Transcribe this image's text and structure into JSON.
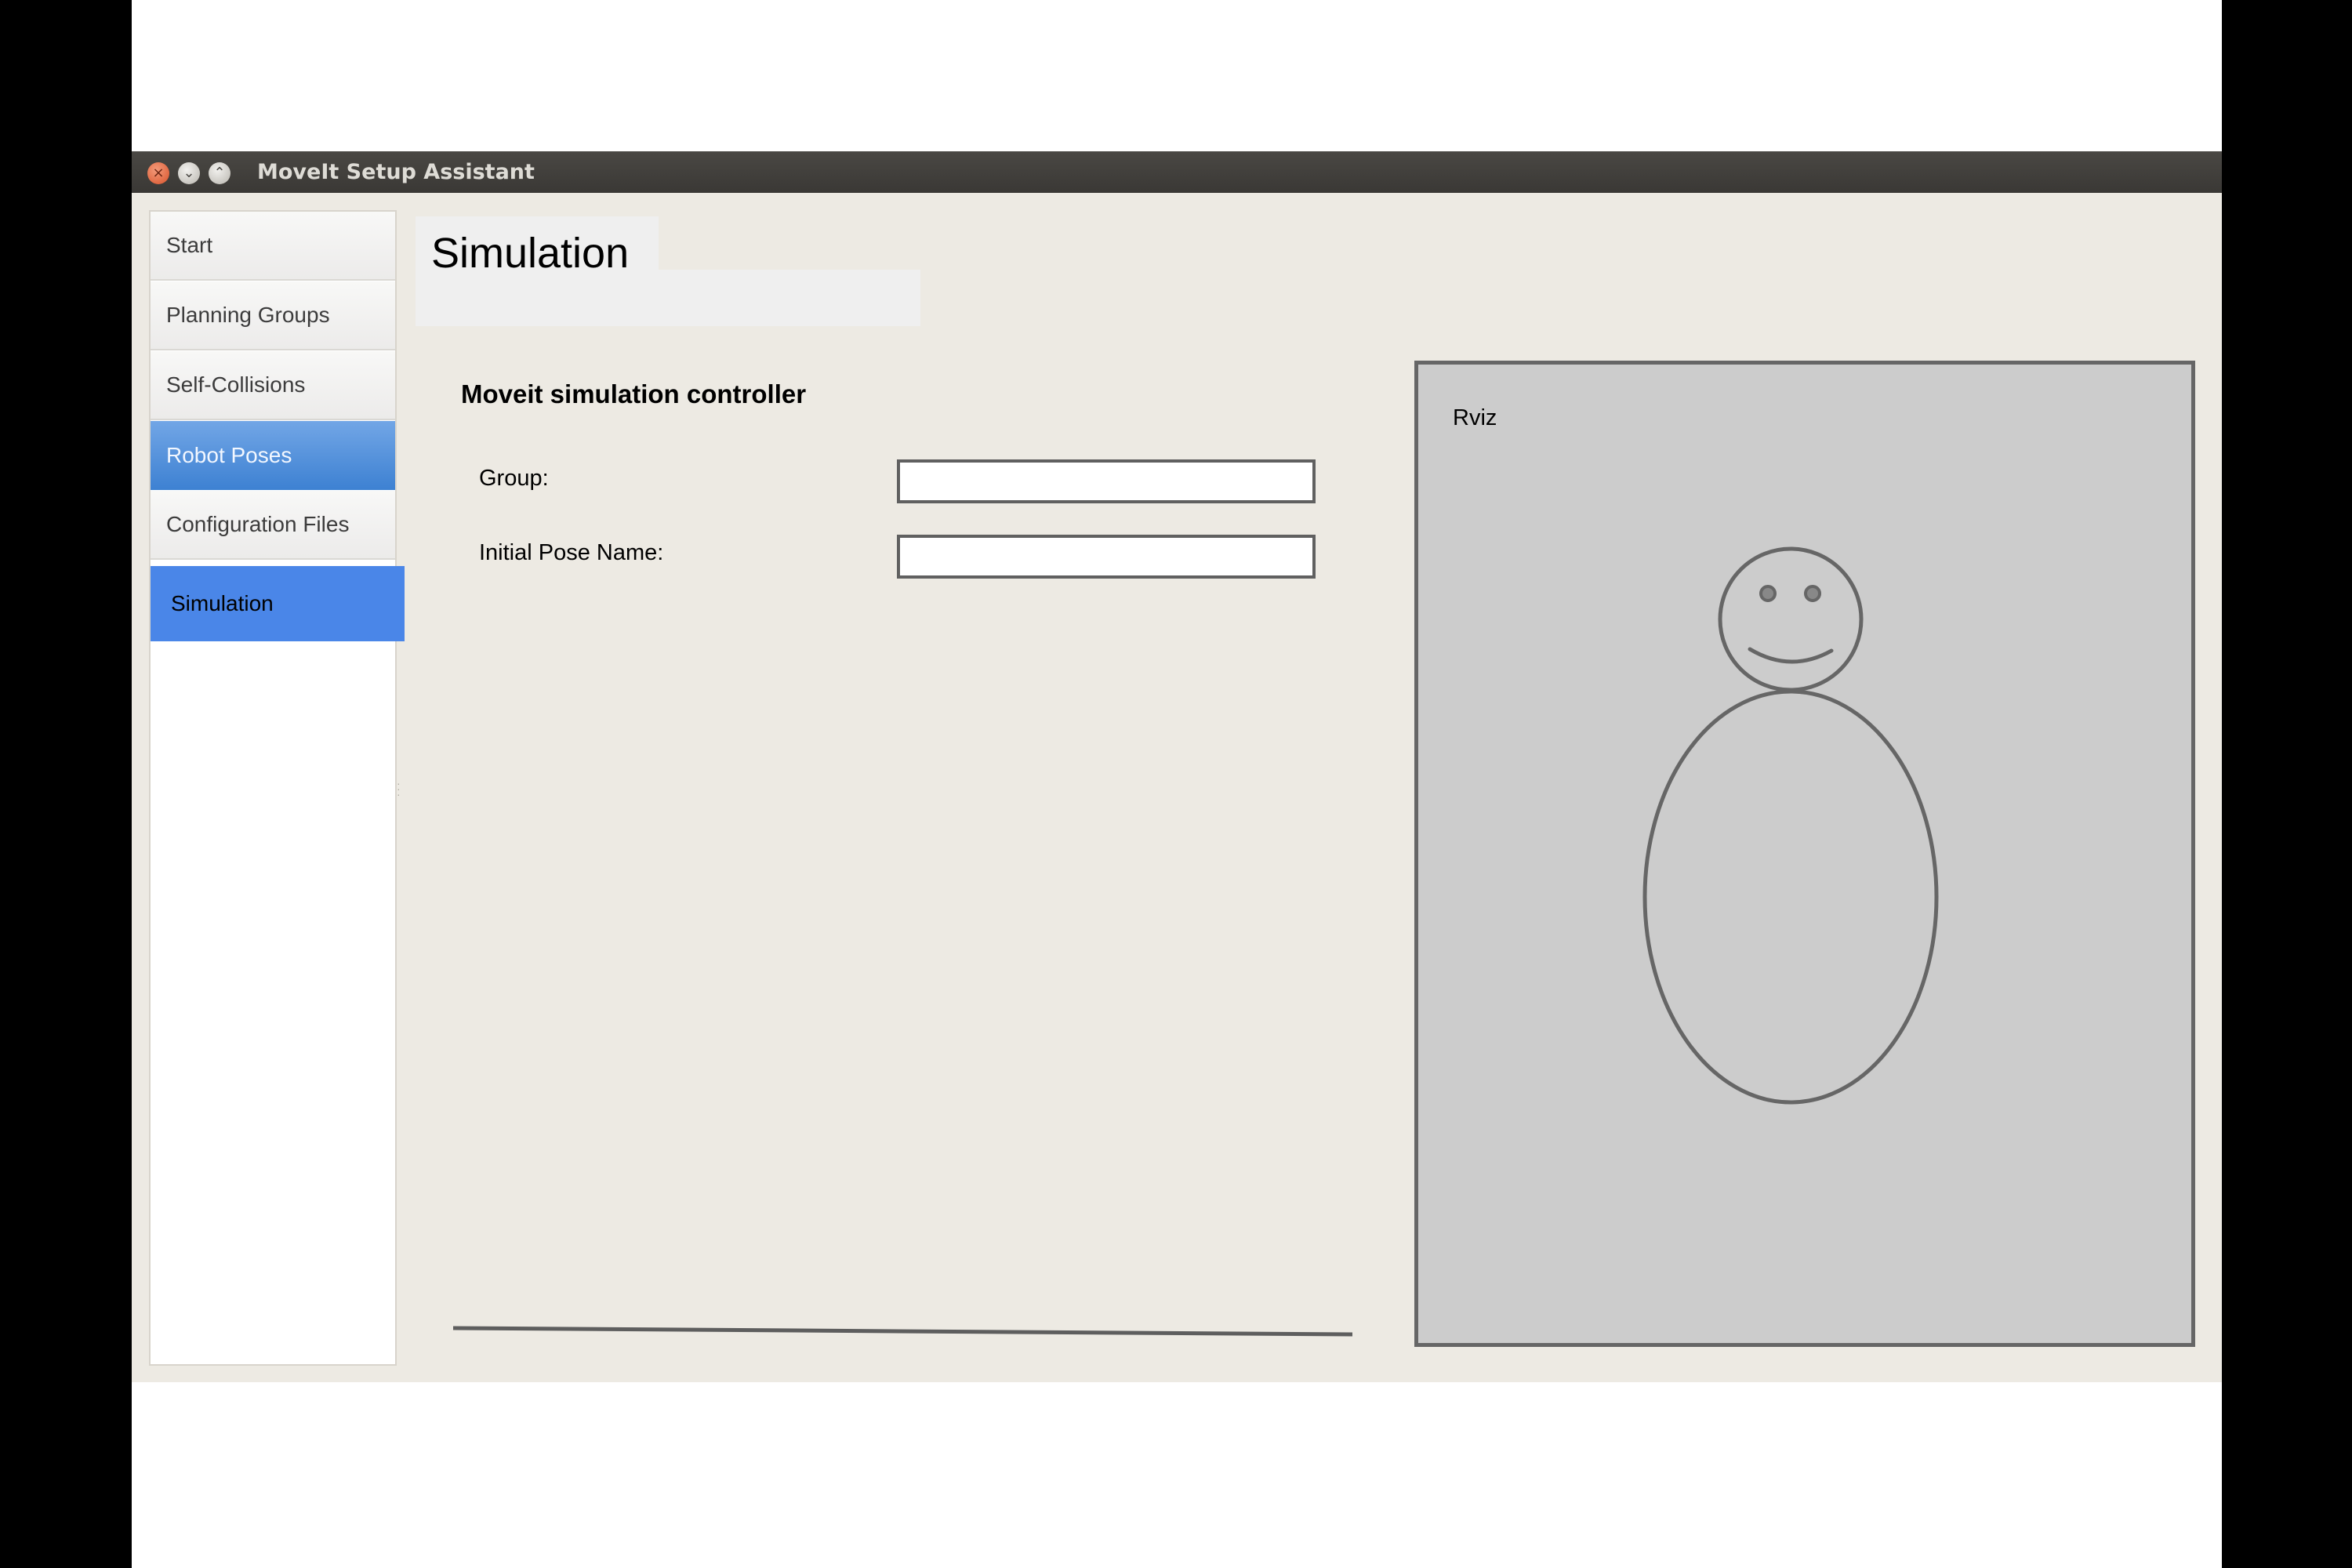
{
  "window": {
    "title": "MoveIt Setup Assistant",
    "controls": {
      "close_icon": "close-icon",
      "minimize_icon": "minimize-icon",
      "maximize_icon": "maximize-icon"
    }
  },
  "sidebar": {
    "items": [
      {
        "label": "Start"
      },
      {
        "label": "Planning Groups"
      },
      {
        "label": "Self-Collisions"
      },
      {
        "label": "Robot Poses"
      },
      {
        "label": "Configuration Files"
      },
      {
        "label": "Simulation"
      }
    ],
    "selected": "Simulation"
  },
  "main": {
    "title": "Simulation",
    "section_heading": "Moveit simulation controller",
    "group_label": "Group:",
    "group_value": "",
    "initial_pose_label": "Initial Pose Name:",
    "initial_pose_value": ""
  },
  "rviz": {
    "label": "Rviz",
    "figure_icon": "robot-figure-icon"
  },
  "colors": {
    "selected_nav": "#4a86e8",
    "robot_poses_nav": "#4f8fdc",
    "panel_bg": "#edeae3",
    "rviz_bg": "#cccccc"
  }
}
